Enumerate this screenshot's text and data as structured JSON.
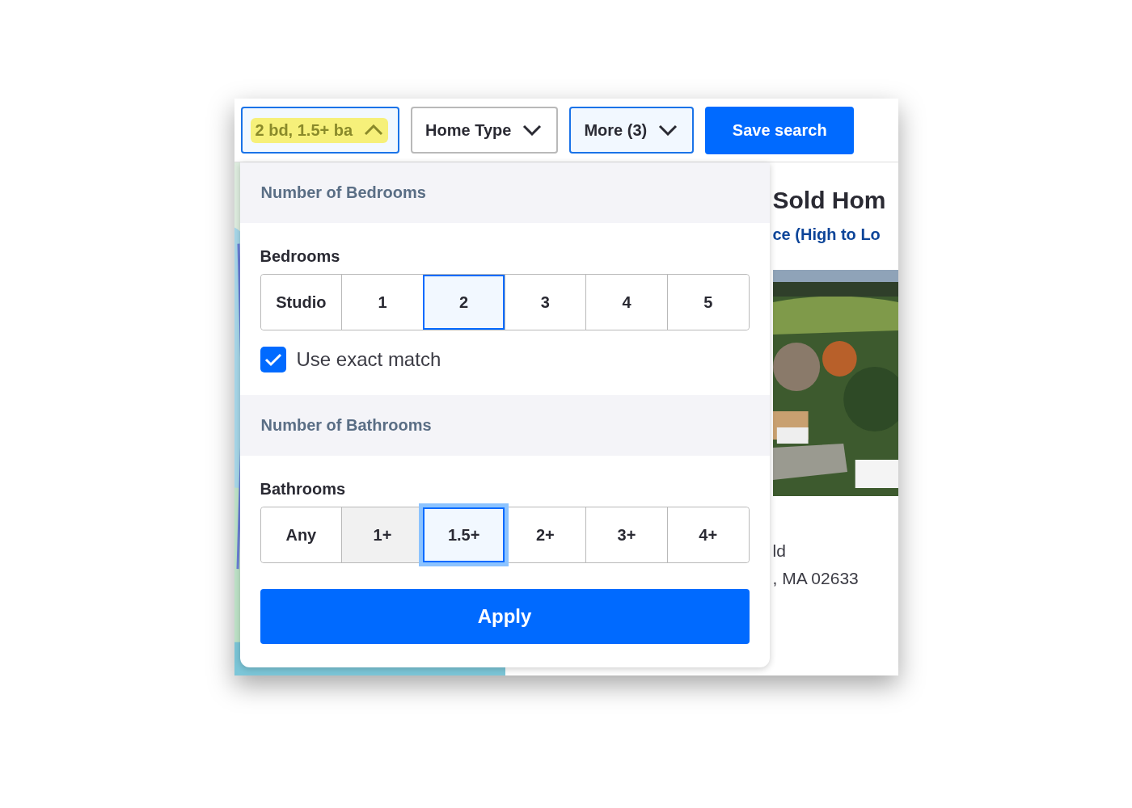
{
  "toolbar": {
    "filters": [
      {
        "label": "2 bd, 1.5+ ba",
        "active": true,
        "expanded": true,
        "highlighted": true
      },
      {
        "label": "Home Type",
        "active": false,
        "expanded": false,
        "highlighted": false
      },
      {
        "label": "More (3)",
        "active": true,
        "expanded": false,
        "highlighted": false
      }
    ],
    "save_button": "Save search"
  },
  "panel": {
    "sections": [
      {
        "heading": "Number of Bedrooms",
        "label": "Bedrooms",
        "options": [
          {
            "label": "Studio",
            "selected": false,
            "hovered": false,
            "focused": false
          },
          {
            "label": "1",
            "selected": false,
            "hovered": false,
            "focused": false
          },
          {
            "label": "2",
            "selected": true,
            "hovered": false,
            "focused": false
          },
          {
            "label": "3",
            "selected": false,
            "hovered": false,
            "focused": false
          },
          {
            "label": "4",
            "selected": false,
            "hovered": false,
            "focused": false
          },
          {
            "label": "5",
            "selected": false,
            "hovered": false,
            "focused": false
          }
        ],
        "checkbox": {
          "label": "Use exact match",
          "checked": true
        }
      },
      {
        "heading": "Number of Bathrooms",
        "label": "Bathrooms",
        "options": [
          {
            "label": "Any",
            "selected": false,
            "hovered": false,
            "focused": false
          },
          {
            "label": "1+",
            "selected": false,
            "hovered": true,
            "focused": false
          },
          {
            "label": "1.5+",
            "selected": true,
            "hovered": false,
            "focused": true
          },
          {
            "label": "2+",
            "selected": false,
            "hovered": false,
            "focused": false
          },
          {
            "label": "3+",
            "selected": false,
            "hovered": false,
            "focused": false
          },
          {
            "label": "4+",
            "selected": false,
            "hovered": false,
            "focused": false
          }
        ]
      }
    ],
    "apply_button": "Apply"
  },
  "listing": {
    "title": "Sold Hom",
    "sort": "ce (High to Lo",
    "line_1": "ld",
    "line_2": ", MA 02633"
  }
}
